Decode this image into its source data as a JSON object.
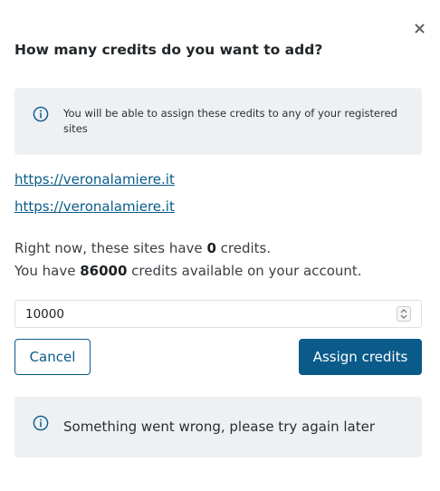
{
  "dialog": {
    "title": "How many credits do you want to add?",
    "close_icon": "close-icon"
  },
  "info_notice": {
    "icon": "info-icon",
    "text": "You will be able to assign these credits to any of your registered sites"
  },
  "sites": [
    {
      "url": "https://veronalamiere.it"
    },
    {
      "url": "https://veronalamiere.it"
    }
  ],
  "summary": {
    "line1_prefix": "Right now, these sites have ",
    "line1_value": "0",
    "line1_suffix": " credits.",
    "line2_prefix": "You have ",
    "line2_value": "86000",
    "line2_suffix": " credits available on your account."
  },
  "amount_input": {
    "value": "10000"
  },
  "buttons": {
    "cancel_label": "Cancel",
    "assign_label": "Assign credits"
  },
  "error_notice": {
    "icon": "info-icon",
    "text": "Something went wrong, please try again later"
  },
  "colors": {
    "accent": "#0a5b8a",
    "notice_bg": "#eef0f4"
  }
}
